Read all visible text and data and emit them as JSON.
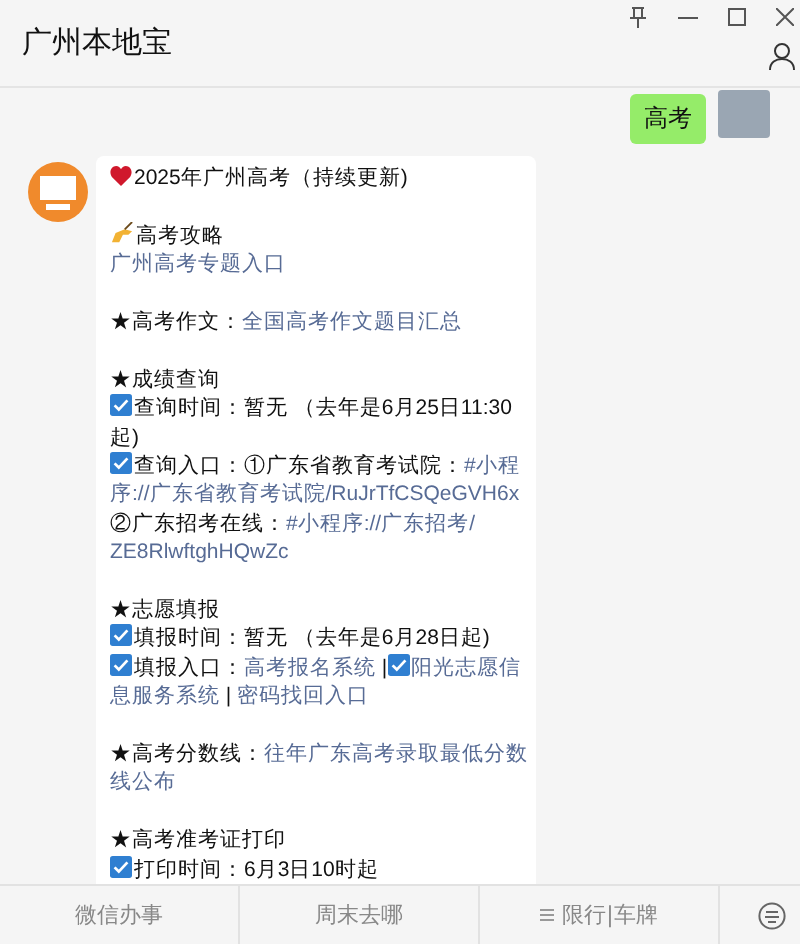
{
  "header": {
    "title": "广州本地宝"
  },
  "user_message": {
    "text": "高考"
  },
  "bot_message": {
    "paragraphs": [
      [
        [
          {
            "kind": "heart"
          },
          {
            "kind": "text",
            "text": "2025年广州高考（持续更新)"
          }
        ]
      ],
      [
        [
          {
            "kind": "hand"
          },
          {
            "kind": "text",
            "text": "高考攻略"
          }
        ],
        [
          {
            "kind": "link",
            "text": "广州高考专题入口"
          }
        ]
      ],
      [
        [
          {
            "kind": "text",
            "text": "★高考作文："
          },
          {
            "kind": "link",
            "text": "全国高考作文题目汇总"
          }
        ]
      ],
      [
        [
          {
            "kind": "text",
            "text": "★成绩查询"
          }
        ],
        [
          {
            "kind": "check"
          },
          {
            "kind": "text",
            "text": "查询时间：暂无 （去年是6月25日11:30"
          }
        ],
        [
          {
            "kind": "text",
            "text": "起)"
          }
        ],
        [
          {
            "kind": "check"
          },
          {
            "kind": "text",
            "text": "查询入口：①广东省教育考试院："
          },
          {
            "kind": "link",
            "text": "#小程"
          }
        ],
        [
          {
            "kind": "link",
            "text": "序://广东省教育考试院/RuJrTfCSQeGVH6x"
          }
        ],
        [
          {
            "kind": "text",
            "text": "②广东招考在线："
          },
          {
            "kind": "link",
            "text": "#小程序://广东招考/"
          }
        ],
        [
          {
            "kind": "link",
            "text": "ZE8RlwftghHQwZc"
          }
        ]
      ],
      [
        [
          {
            "kind": "text",
            "text": "★志愿填报"
          }
        ],
        [
          {
            "kind": "check"
          },
          {
            "kind": "text",
            "text": "填报时间：暂无 （去年是6月28日起)"
          }
        ],
        [
          {
            "kind": "check"
          },
          {
            "kind": "text",
            "text": "填报入口："
          },
          {
            "kind": "link",
            "text": "高考报名系统"
          },
          {
            "kind": "text",
            "text": " |"
          },
          {
            "kind": "check"
          },
          {
            "kind": "link",
            "text": "阳光志愿信"
          }
        ],
        [
          {
            "kind": "link",
            "text": "息服务系统"
          },
          {
            "kind": "text",
            "text": " | "
          },
          {
            "kind": "link",
            "text": "密码找回入口"
          }
        ]
      ],
      [
        [
          {
            "kind": "text",
            "text": "★高考分数线："
          },
          {
            "kind": "link",
            "text": "往年广东高考录取最低分数"
          }
        ],
        [
          {
            "kind": "link",
            "text": "线公布"
          }
        ]
      ],
      [
        [
          {
            "kind": "text",
            "text": "★高考准考证打印"
          }
        ],
        [
          {
            "kind": "check"
          },
          {
            "kind": "text",
            "text": "打印时间：6月3日10时起"
          }
        ]
      ]
    ]
  },
  "menu": {
    "items": [
      {
        "label": "微信办事",
        "list_icon": false
      },
      {
        "label": "周末去哪",
        "list_icon": false
      },
      {
        "label": "限行|车牌",
        "list_icon": true
      }
    ]
  }
}
